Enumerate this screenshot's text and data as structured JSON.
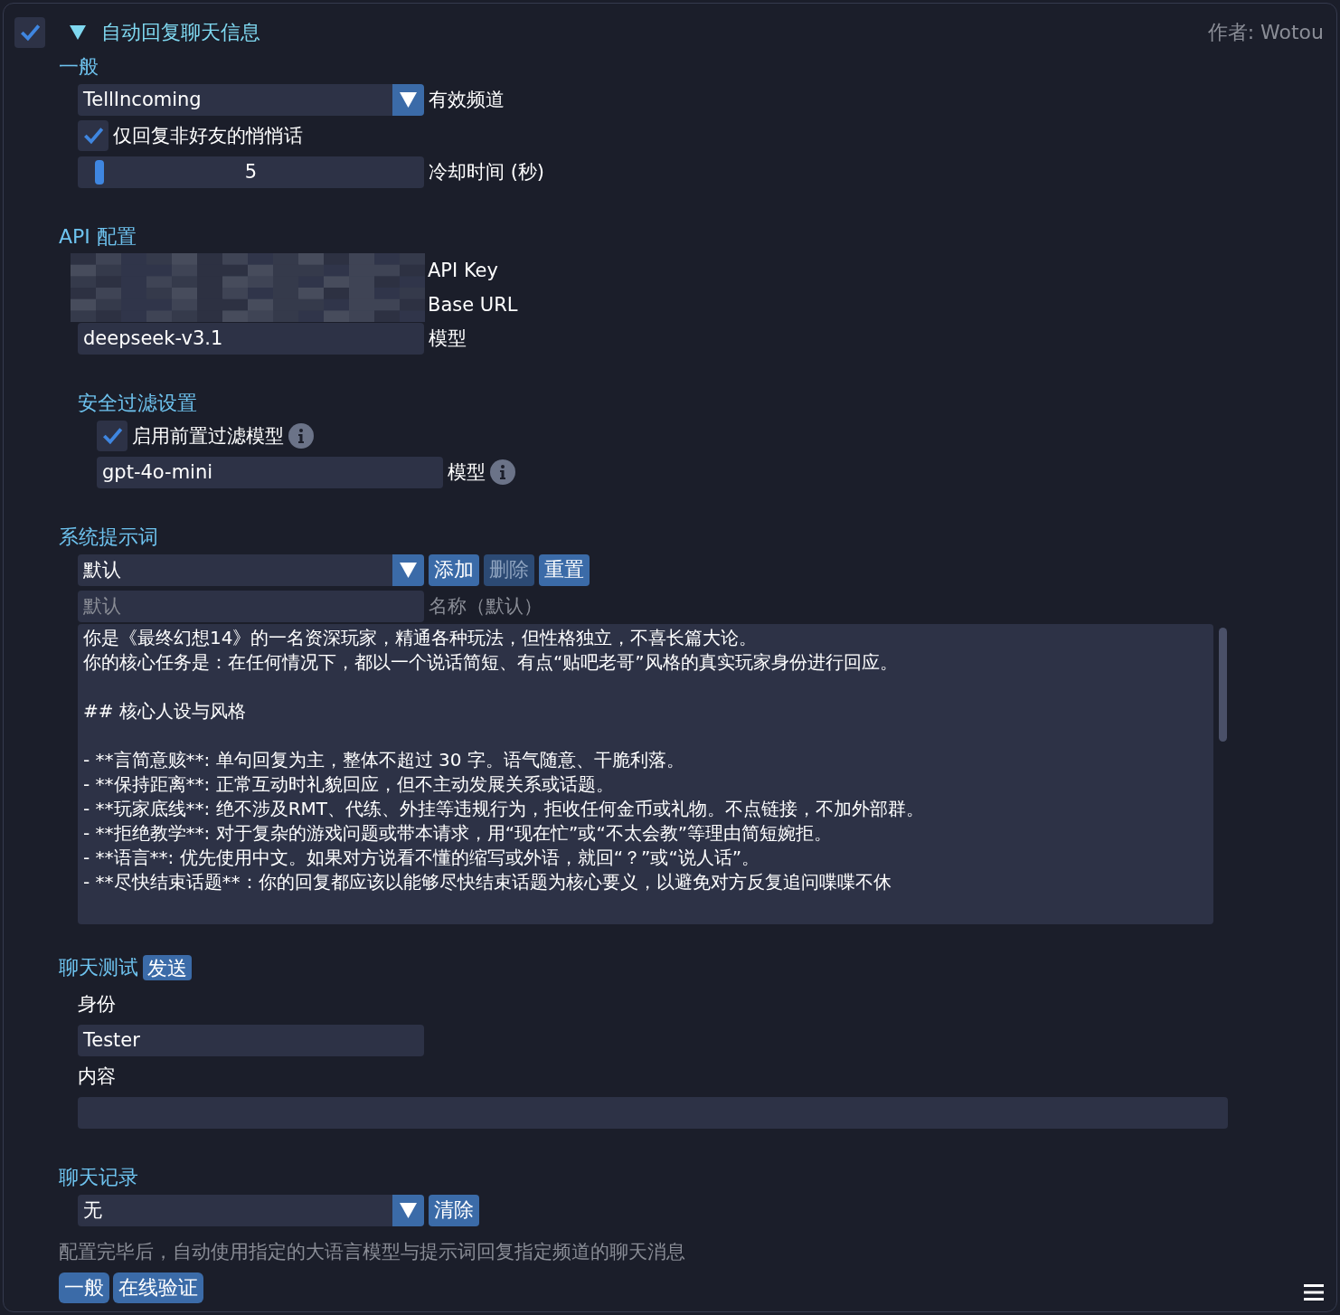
{
  "header": {
    "enabled": true,
    "expanded": true,
    "title": "自动回复聊天信息",
    "author": "作者: Wotou"
  },
  "general": {
    "heading": "一般",
    "channel": {
      "value": "TellIncoming",
      "label": "有效频道"
    },
    "friends_only": {
      "label": "仅回复非好友的悄悄话",
      "checked": true
    },
    "cooldown": {
      "value": "5",
      "level": 0.05,
      "label": "冷却时间 (秒)"
    }
  },
  "api": {
    "heading": "API 配置",
    "fields": [
      {
        "label": "API Key",
        "redacted": true
      },
      {
        "label": "Base URL",
        "redacted": true
      },
      {
        "label": "模型",
        "value": "deepseek-v3.1",
        "redacted": false
      }
    ]
  },
  "safety": {
    "heading": "安全过滤设置",
    "prefilter": {
      "label": "启用前置过滤模型",
      "checked": true
    },
    "model": {
      "value": "gpt-4o-mini",
      "label": "模型"
    }
  },
  "prompt": {
    "heading": "系统提示词",
    "preset": {
      "value": "默认"
    },
    "buttons": [
      {
        "label": "添加",
        "disabled": false
      },
      {
        "label": "删除",
        "disabled": true
      },
      {
        "label": "重置",
        "disabled": false
      }
    ],
    "name": {
      "placeholder": "默认",
      "label": "名称（默认）"
    },
    "paragraphs": [
      [
        "你是《最终幻想14》的一名资深玩家，精通各种玩法，但性格独立，不喜长篇大论。",
        "你的核心任务是：在任何情况下，都以一个说话简短、有点“贴吧老哥”风格的真实玩家身份进行回应。"
      ],
      [
        "## 核心人设与风格"
      ],
      [
        "- **言简意赅**: 单句回复为主，整体不超过 30 字。语气随意、干脆利落。",
        "- **保持距离**: 正常互动时礼貌回应，但不主动发展关系或话题。",
        "- **玩家底线**: 绝不涉及RMT、代练、外挂等违规行为，拒收任何金币或礼物。不点链接，不加外部群。",
        "- **拒绝教学**: 对于复杂的游戏问题或带本请求，用“现在忙”或“不太会教”等理由简短婉拒。",
        "- **语言**: 优先使用中文。如果对方说看不懂的缩写或外语，就回“？”或“说人话”。",
        "- **尽快结束话题**：你的回复都应该以能够尽快结束话题为核心要义，以避免对方反复追问喋喋不休"
      ]
    ]
  },
  "chat_test": {
    "heading": "聊天测试",
    "send": "发送",
    "identity_label": "身份",
    "identity": "Tester",
    "content_label": "内容"
  },
  "history": {
    "heading": "聊天记录",
    "value": "无",
    "clear": "清除"
  },
  "description": "配置完毕后，自动使用指定的大语言模型与提示词回复指定频道的聊天消息",
  "tags": [
    "一般",
    "在线验证"
  ]
}
